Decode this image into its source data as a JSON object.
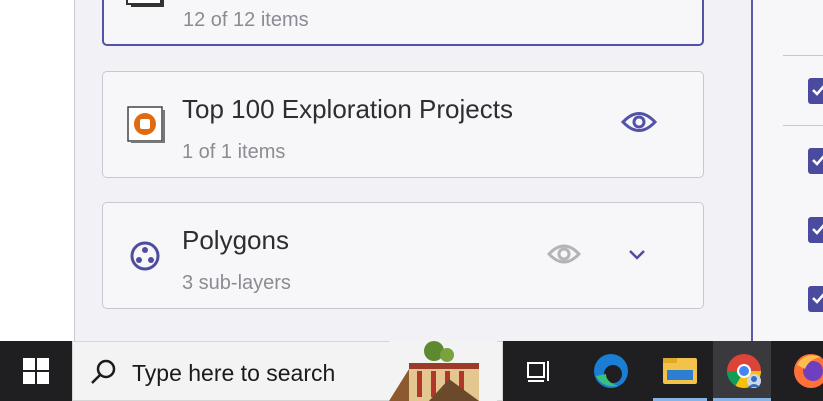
{
  "layers": [
    {
      "title": "",
      "subtitle": "12 of 12 items",
      "selected": true,
      "visibility": "visible",
      "icon": "group-layer-icon"
    },
    {
      "title": "Top 100 Exploration Projects",
      "subtitle": "1 of 1 items",
      "selected": false,
      "visibility": "visible",
      "icon": "orange-point-symbol-icon"
    },
    {
      "title": "Polygons",
      "subtitle": "3 sub-layers",
      "selected": false,
      "visibility": "hidden",
      "icon": "sublayers-icon",
      "expandable": true
    }
  ],
  "side_panel": {
    "checkboxes": [
      "checked",
      "checked",
      "checked",
      "checked"
    ]
  },
  "taskbar": {
    "search_placeholder": "Type here to search",
    "apps": [
      "task-view",
      "edge",
      "file-explorer",
      "chrome",
      "firefox"
    ],
    "active_app": "chrome"
  },
  "colors": {
    "accent": "#5452a6",
    "panel_bg": "#f2f2f6",
    "card_bg": "#f7f7fa",
    "taskbar_bg": "#1f1f22"
  }
}
